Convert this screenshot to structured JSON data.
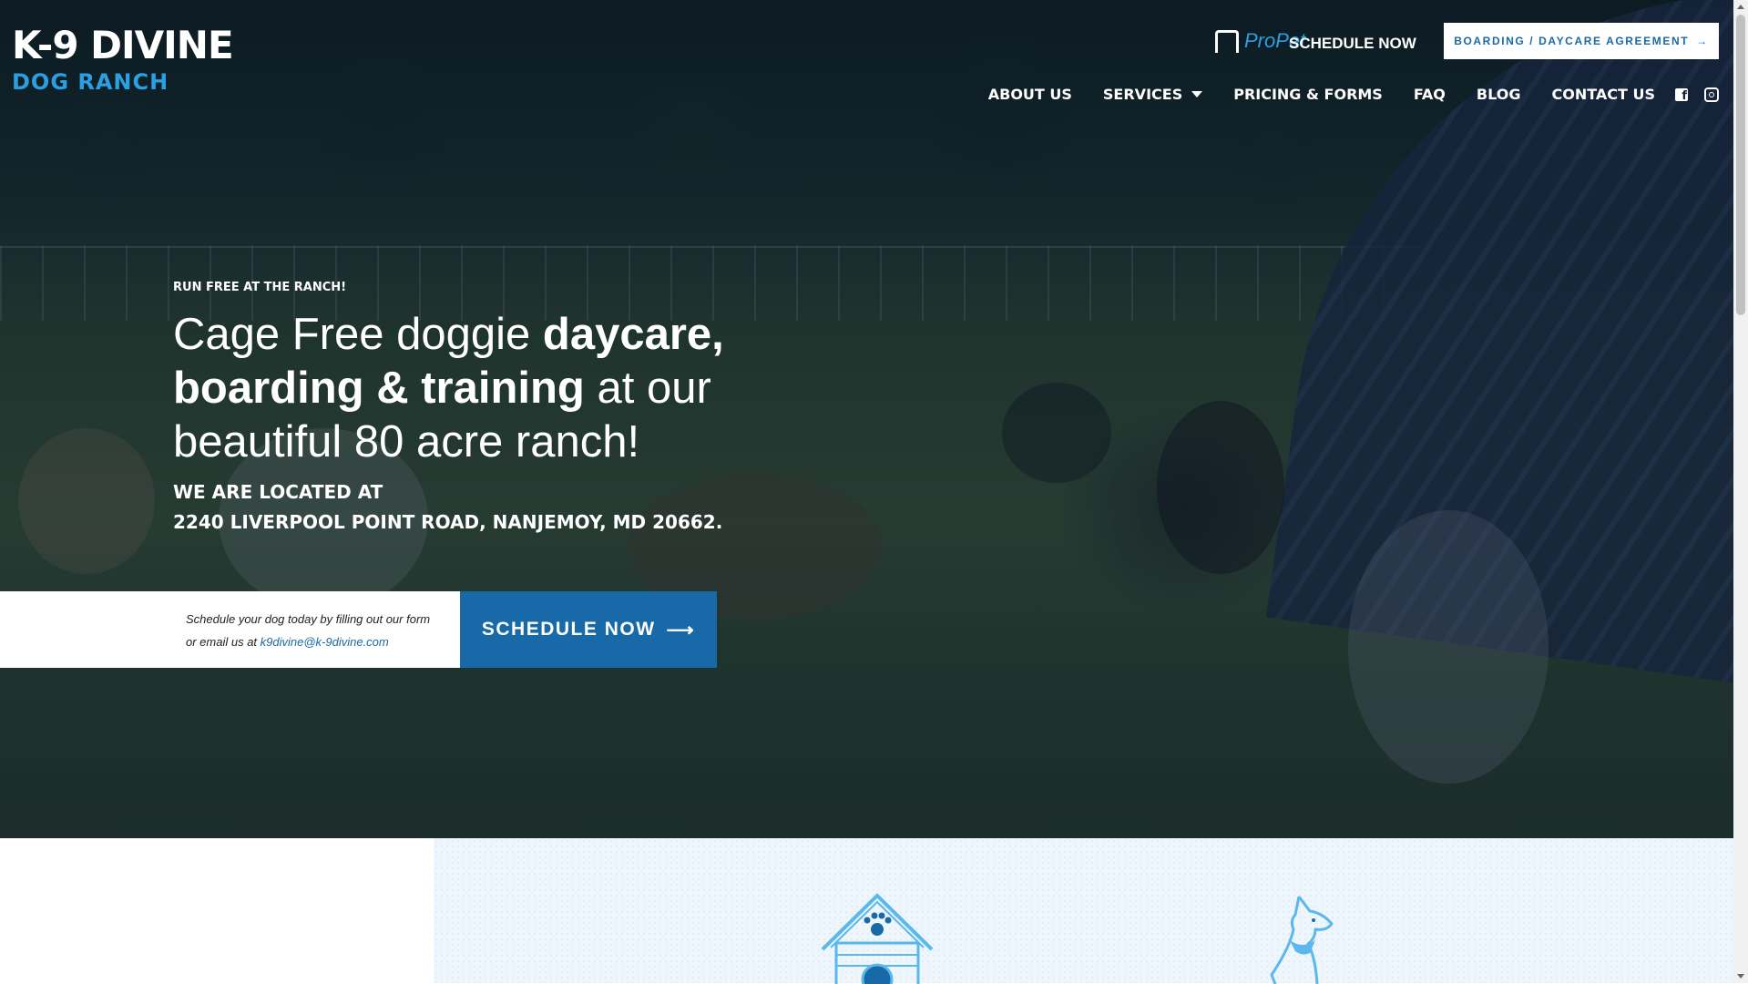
{
  "logo": {
    "line1": "K-9 DIVINE",
    "line2": "DOG RANCH"
  },
  "header": {
    "propet_label": "ProPet",
    "schedule_label": "SCHEDULE NOW",
    "agreement_button": "BOARDING / DAYCARE AGREEMENT",
    "agreement_arrow": "→"
  },
  "nav": {
    "items": [
      "ABOUT US",
      "SERVICES",
      "PRICING & FORMS",
      "FAQ",
      "BLOG",
      "CONTACT US"
    ]
  },
  "social": {
    "icons": [
      "facebook-icon",
      "instagram-icon"
    ]
  },
  "hero": {
    "eyebrow": "RUN FREE AT THE RANCH!",
    "headline": {
      "part1": "Cage Free doggie ",
      "bold1": "daycare,",
      "bold2": "boarding & training",
      "part2": " at our",
      "part3": "beautiful 80 acre ranch!"
    },
    "address_line1": "WE ARE LOCATED AT",
    "address_line2": "2240 LIVERPOOL POINT ROAD, NANJEMOY, MD 20662."
  },
  "schedule": {
    "text_line1": "Schedule your dog today by filling out our form",
    "text_line2_prefix": "or email us at ",
    "email": "k9divine@k-9divine.com",
    "button_label": "SCHEDULE NOW",
    "button_arrow": "⟶"
  },
  "colors": {
    "accent_blue": "#1769a8",
    "logo_blue": "#2aa0e2",
    "white": "#ffffff"
  }
}
